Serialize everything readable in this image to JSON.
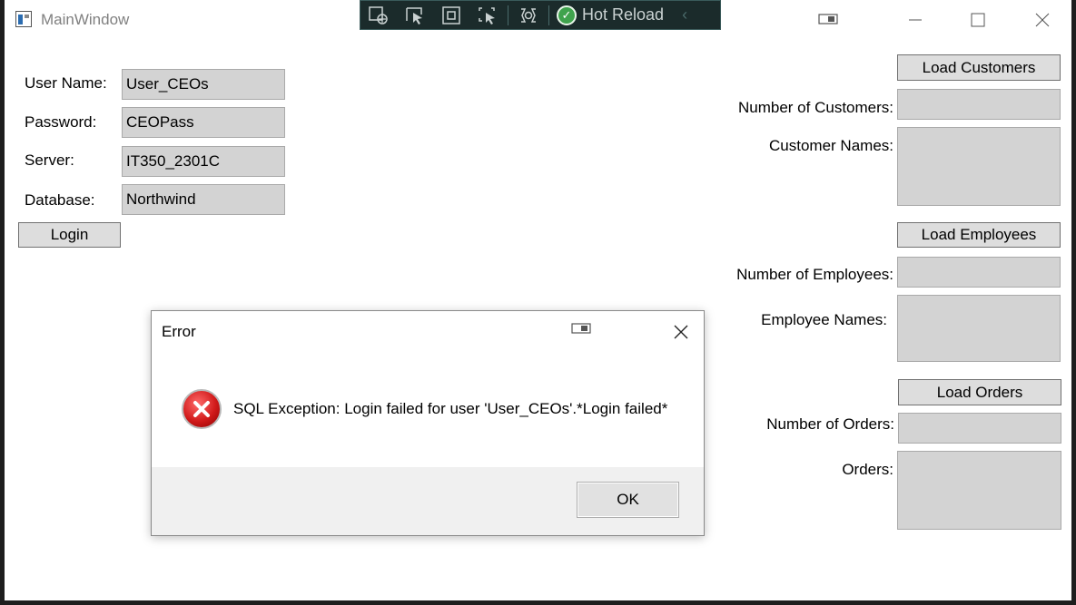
{
  "window": {
    "title": "MainWindow"
  },
  "devtools": {
    "hot_reload_label": "Hot Reload"
  },
  "login": {
    "username_label": "User Name:",
    "username_value": "User_CEOs",
    "password_label": "Password:",
    "password_value": "CEOPass",
    "server_label": "Server:",
    "server_value": "IT350_2301C",
    "database_label": "Database:",
    "database_value": "Northwind",
    "login_button": "Login"
  },
  "customers": {
    "load_button": "Load Customers",
    "count_label": "Number of Customers:",
    "count_value": "",
    "names_label": "Customer Names:",
    "names_value": ""
  },
  "employees": {
    "load_button": "Load Employees",
    "count_label": "Number of Employees:",
    "count_value": "",
    "names_label": "Employee Names:",
    "names_value": ""
  },
  "orders": {
    "load_button": "Load Orders",
    "count_label": "Number of Orders:",
    "count_value": "",
    "names_label": "Orders:",
    "names_value": ""
  },
  "error_dialog": {
    "title": "Error",
    "message": "SQL Exception: Login failed for user 'User_CEOs'.*Login failed*",
    "ok_button": "OK"
  },
  "colors": {
    "field_bg": "#d3d3d3",
    "hot_reload_green": "#3fa34d",
    "error_red": "#d11a1a"
  }
}
